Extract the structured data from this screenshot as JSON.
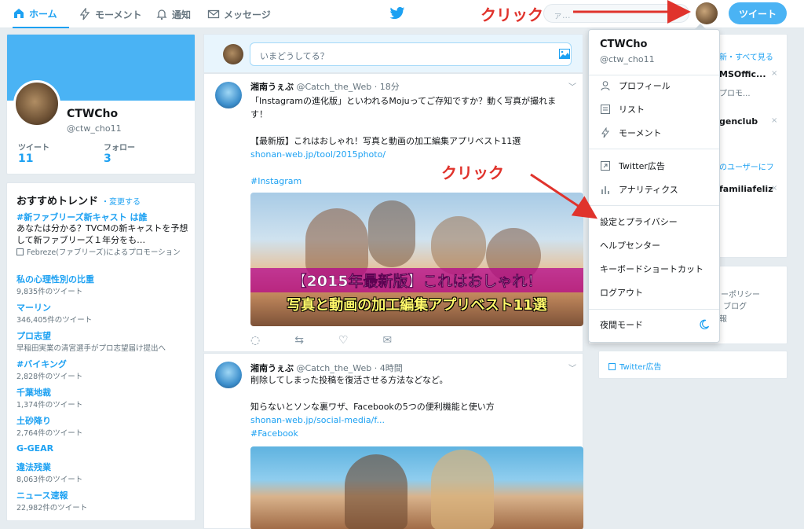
{
  "nav": {
    "home": "ホーム",
    "moments": "モーメント",
    "notifications": "通知",
    "messages": "メッセージ",
    "search_placeholder": "ァ...",
    "tweet_button": "ツイート"
  },
  "profile": {
    "name": "CTWCho",
    "handle": "@ctw_cho11",
    "tweets_label": "ツイート",
    "tweets_value": "11",
    "following_label": "フォロー",
    "following_value": "3"
  },
  "trends": {
    "title": "おすすめトレンド",
    "change": "・変更する",
    "items": [
      {
        "name": "#新ファブリーズ新キャスト は誰",
        "desc": "あなたは分かる？TVCMの新キャストを予想して新ファブリーズ１年分をも…",
        "promo": "Febreze(ファブリーズ)によるプロモーション"
      },
      {
        "name": "私の心理性別の比重",
        "sub": "9,835件のツイート"
      },
      {
        "name": "マーリン",
        "sub": "346,405件のツイート"
      },
      {
        "name": "プロ志望",
        "sub": "早稲田実業の清宮選手がプロ志望届け提出へ"
      },
      {
        "name": "#バイキング",
        "sub": "2,828件のツイート"
      },
      {
        "name": "千葉地裁",
        "sub": "1,374件のツイート"
      },
      {
        "name": "土砂降り",
        "sub": "2,764件のツイート"
      },
      {
        "name": "G-GEAR",
        "sub": ""
      },
      {
        "name": "違法残業",
        "sub": "8,063件のツイート"
      },
      {
        "name": "ニュース速報",
        "sub": "22,982件のツイート"
      }
    ]
  },
  "compose": {
    "placeholder": "いまどうしてる？"
  },
  "tweets": [
    {
      "author": "湘南うぇぶ",
      "handle": "@Catch_the_Web",
      "time": "· 18分",
      "line1": "「Instagramの進化版」といわれるMojuってご存知ですか？動く写真が撮れま",
      "line2": "す！",
      "line3": "【最新版】これはおしゃれ！写真と動画の加工編集アプリベスト11選",
      "link": "shonan-web.jp/tool/2015photo/",
      "hashtag": "#Instagram",
      "image_caption1": "【2015年最新版】これはおしゃれ！",
      "image_caption2": "写真と動画の加工編集アプリベスト11選"
    },
    {
      "author": "湘南うぇぶ",
      "handle": "@Catch_the_Web",
      "time": "· 4時間",
      "line1": "削除してしまった投稿を復活させる方法などなど。",
      "line2": "知らないとソンな裏ワザ、Facebookの5つの便利機能と使い方",
      "link": "shonan-web.jp/social-media/f...",
      "hashtag": "#Facebook"
    }
  ],
  "right": {
    "wtf_more": "新・すべて見る",
    "wtf1": "MSOffic...",
    "wtf1_promo": "プロモ...",
    "wtf2": "genclub",
    "wtf_find": "のユーザーにフ",
    "wtf3": "familiafeliz",
    "footer1": "シーポリシー",
    "footer2": "ド  ブログ",
    "footer3": "報",
    "ads": "Twitter広告"
  },
  "dropdown": {
    "name": "CTWCho",
    "handle": "@ctw_cho11",
    "profile": "プロフィール",
    "lists": "リスト",
    "moments": "モーメント",
    "ads": "Twitter広告",
    "analytics": "アナリティクス",
    "settings": "設定とプライバシー",
    "help": "ヘルプセンター",
    "shortcuts": "キーボードショートカット",
    "logout": "ログアウト",
    "night": "夜間モード"
  },
  "annotations": {
    "click1": "クリック",
    "click2": "クリック",
    "color": "#e0332c"
  }
}
